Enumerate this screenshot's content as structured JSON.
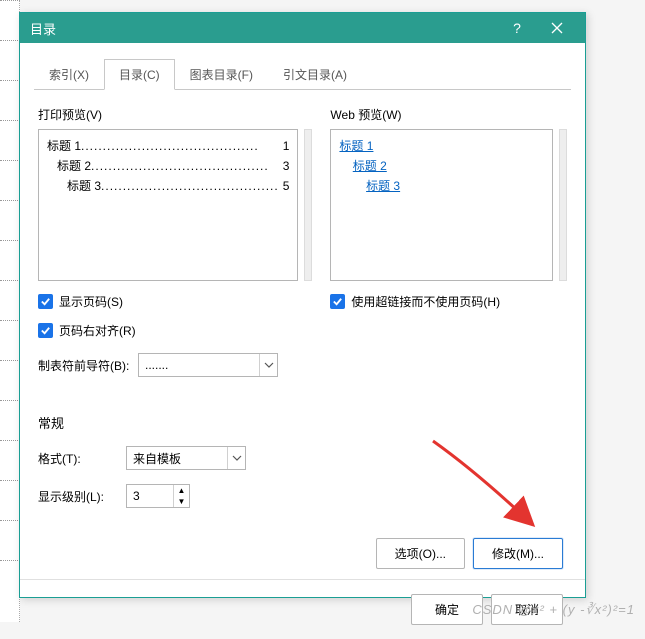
{
  "titlebar": {
    "title": "目录"
  },
  "tabs": [
    {
      "label": "索引(X)"
    },
    {
      "label": "目录(C)"
    },
    {
      "label": "图表目录(F)"
    },
    {
      "label": "引文目录(A)"
    }
  ],
  "print_preview": {
    "label": "打印预览(V)",
    "lines": [
      {
        "indent": "",
        "text": "标题 1",
        "page": "1"
      },
      {
        "indent": "   ",
        "text": "标题 2",
        "page": "3"
      },
      {
        "indent": "      ",
        "text": "标题 3",
        "page": "5"
      }
    ]
  },
  "web_preview": {
    "label": "Web 预览(W)",
    "lines": [
      {
        "indent": "",
        "text": "标题 1"
      },
      {
        "indent": "    ",
        "text": "标题 2"
      },
      {
        "indent": "        ",
        "text": "标题 3"
      }
    ]
  },
  "checks": {
    "show_page": "显示页码(S)",
    "right_align": "页码右对齐(R)",
    "hyperlink": "使用超链接而不使用页码(H)"
  },
  "leader": {
    "label": "制表符前导符(B):",
    "value": "......."
  },
  "general": {
    "title": "常规",
    "format_label": "格式(T):",
    "format_value": "来自模板",
    "levels_label": "显示级别(L):",
    "levels_value": "3"
  },
  "buttons": {
    "options": "选项(O)...",
    "modify": "修改(M)...",
    "ok": "确定",
    "cancel": "取消"
  },
  "watermark": "CSDN @x² + (y -∛x²)²=1"
}
